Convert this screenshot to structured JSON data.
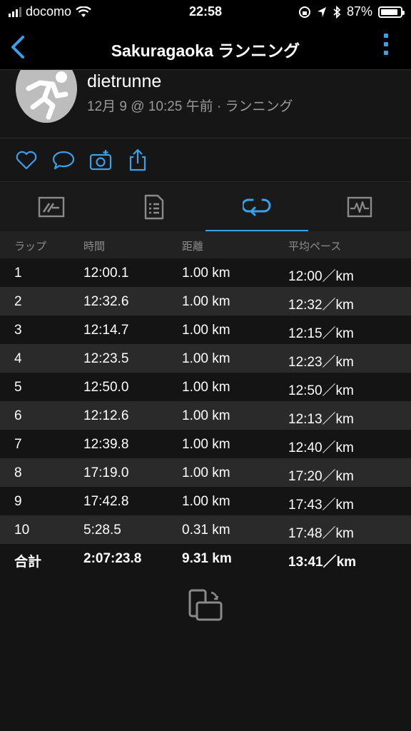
{
  "status_bar": {
    "carrier": "docomo",
    "time": "22:58",
    "battery_percent": "87%"
  },
  "nav": {
    "title": "Sakuragaoka ランニング"
  },
  "activity": {
    "user_name": "dietrunne",
    "meta": "12月 9 @ 10:25 午前 · ランニング"
  },
  "laps": {
    "headers": {
      "lap": "ラップ",
      "time": "時間",
      "distance": "距離",
      "avg_pace": "平均ペース"
    },
    "rows": [
      {
        "lap": "1",
        "time": "12:00.1",
        "distance": "1.00 km",
        "pace": "12:00／km"
      },
      {
        "lap": "2",
        "time": "12:32.6",
        "distance": "1.00 km",
        "pace": "12:32／km"
      },
      {
        "lap": "3",
        "time": "12:14.7",
        "distance": "1.00 km",
        "pace": "12:15／km"
      },
      {
        "lap": "4",
        "time": "12:23.5",
        "distance": "1.00 km",
        "pace": "12:23／km"
      },
      {
        "lap": "5",
        "time": "12:50.0",
        "distance": "1.00 km",
        "pace": "12:50／km"
      },
      {
        "lap": "6",
        "time": "12:12.6",
        "distance": "1.00 km",
        "pace": "12:13／km"
      },
      {
        "lap": "7",
        "time": "12:39.8",
        "distance": "1.00 km",
        "pace": "12:40／km"
      },
      {
        "lap": "8",
        "time": "17:19.0",
        "distance": "1.00 km",
        "pace": "17:20／km"
      },
      {
        "lap": "9",
        "time": "17:42.8",
        "distance": "1.00 km",
        "pace": "17:43／km"
      },
      {
        "lap": "10",
        "time": "5:28.5",
        "distance": "0.31 km",
        "pace": "17:48／km"
      }
    ],
    "total": {
      "label": "合計",
      "time": "2:07:23.8",
      "distance": "9.31 km",
      "pace": "13:41／km"
    }
  },
  "colors": {
    "accent": "#3aa0ea",
    "background": "#141414",
    "row_alt": "#2a2a2a"
  },
  "icons": [
    "back-chevron-icon",
    "more-vertical-icon",
    "like-heart-icon",
    "comment-bubble-icon",
    "add-photo-icon",
    "share-icon",
    "stats-tab-icon",
    "details-tab-icon",
    "laps-tab-icon",
    "chart-tab-icon",
    "rotate-device-icon"
  ]
}
